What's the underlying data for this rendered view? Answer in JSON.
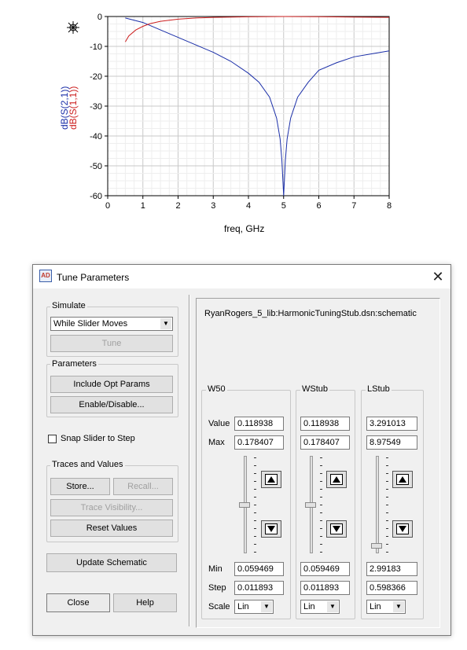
{
  "plot": {
    "y_label_s21": "dB(S(2,1))",
    "y_label_s11": "dB(S(1,1))",
    "x_label": "freq, GHz",
    "x_ticks": [
      "0",
      "1",
      "2",
      "3",
      "4",
      "5",
      "6",
      "7",
      "8"
    ],
    "y_ticks": [
      "0",
      "-10",
      "-20",
      "-30",
      "-40",
      "-50",
      "-60"
    ],
    "colors": {
      "s21": "#1a2ea8",
      "s11": "#cc1f1f"
    },
    "marker_icon": "crosshair-marker-icon"
  },
  "chart_data": {
    "type": "line",
    "title": "",
    "xlabel": "freq, GHz",
    "ylabel": "dB(S(2,1)), dB(S(1,1))",
    "xlim": [
      0,
      8
    ],
    "ylim": [
      -60,
      0
    ],
    "grid": true,
    "series": [
      {
        "name": "dB(S(2,1))",
        "color": "#1a2ea8",
        "x": [
          0.5,
          1.0,
          1.5,
          2.0,
          2.5,
          3.0,
          3.5,
          4.0,
          4.3,
          4.6,
          4.8,
          4.9,
          4.95,
          5.0,
          5.05,
          5.1,
          5.2,
          5.4,
          5.7,
          6.0,
          6.5,
          7.0,
          7.5,
          8.0
        ],
        "y": [
          -0.5,
          -2.0,
          -4.5,
          -7.0,
          -9.5,
          -12.0,
          -15.0,
          -19.0,
          -22.0,
          -27.0,
          -34.0,
          -41.0,
          -48.0,
          -60.0,
          -48.0,
          -41.0,
          -34.0,
          -27.0,
          -22.0,
          -18.0,
          -15.5,
          -13.5,
          -12.5,
          -11.5
        ]
      },
      {
        "name": "dB(S(1,1))",
        "color": "#cc1f1f",
        "x": [
          0.5,
          0.6,
          0.8,
          1.0,
          1.2,
          1.5,
          2.0,
          2.5,
          3.0,
          4.0,
          5.0,
          6.0,
          7.0,
          8.0
        ],
        "y": [
          -8.5,
          -6.5,
          -4.5,
          -3.3,
          -2.4,
          -1.6,
          -0.9,
          -0.5,
          -0.3,
          -0.1,
          0.0,
          -0.05,
          -0.2,
          -0.3
        ]
      }
    ]
  },
  "dialog": {
    "title": "Tune Parameters",
    "simulate": {
      "group_label": "Simulate",
      "mode_value": "While Slider Moves",
      "tune_label": "Tune"
    },
    "parameters": {
      "group_label": "Parameters",
      "include_opt_label": "Include Opt Params",
      "enable_disable_label": "Enable/Disable..."
    },
    "snap_label": "Snap Slider to Step",
    "traces": {
      "group_label": "Traces and Values",
      "store_label": "Store...",
      "recall_label": "Recall...",
      "trace_visibility_label": "Trace Visibility...",
      "reset_label": "Reset Values"
    },
    "update_schematic_label": "Update Schematic",
    "close_label": "Close",
    "help_label": "Help",
    "schematic_path": "RyanRogers_5_lib:HarmonicTuningStub.dsn:schematic",
    "row_labels": {
      "value": "Value",
      "max": "Max",
      "min": "Min",
      "step": "Step",
      "scale": "Scale"
    },
    "params": [
      {
        "name": "W50",
        "value": "0.118938",
        "max": "0.178407",
        "min": "0.059469",
        "step": "0.011893",
        "scale": "Lin",
        "slider_fraction": 0.5
      },
      {
        "name": "WStub",
        "value": "0.118938",
        "max": "0.178407",
        "min": "0.059469",
        "step": "0.011893",
        "scale": "Lin",
        "slider_fraction": 0.5
      },
      {
        "name": "LStub",
        "value": "3.291013",
        "max": "8.97549",
        "min": "2.99183",
        "step": "0.598366",
        "scale": "Lin",
        "slider_fraction": 0.05
      }
    ]
  }
}
